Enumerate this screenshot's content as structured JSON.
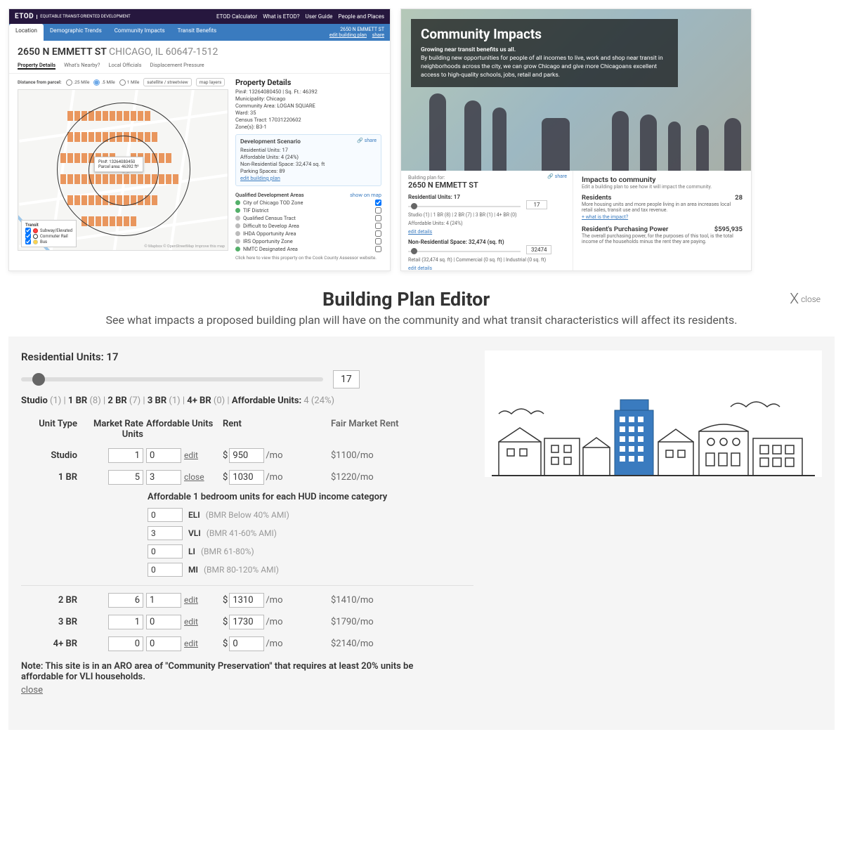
{
  "header": {
    "logo": "ETOD",
    "tagline": "EQUITABLE TRANSIT-ORIENTED DEVELOPMENT",
    "nav": [
      "ETOD Calculator",
      "What is ETOD?",
      "User Guide",
      "People and Places"
    ]
  },
  "subheader": {
    "tabs": [
      "Location",
      "Demographic Trends",
      "Community Impacts",
      "Transit Benefits"
    ],
    "right_addr": "2650 N EMMETT ST",
    "right_edit": "edit building plan",
    "right_share": "share"
  },
  "address": {
    "street": "2650 N EMMETT ST",
    "city": "CHICAGO, IL 60647-1512"
  },
  "prop_tabs": [
    "Property Details",
    "What's Nearby?",
    "Local Officials",
    "Displacement Pressure"
  ],
  "map": {
    "dist_label": "Distance from parcel:",
    "radii": [
      ".25 Mile",
      ".5 Mile",
      "1 Mile"
    ],
    "sat": "satellite / streetview",
    "layers": "map layers",
    "popup_pin": "Pin#: 13264080450",
    "popup_area": "Parcel area: 46392 ft²",
    "legend_title": "Transit",
    "legend": [
      "Subway/Elevated",
      "Commuter Rail",
      "Bus"
    ],
    "credit": "© Mapbox © OpenStreetMap Improve this map"
  },
  "details": {
    "title": "Property Details",
    "pin": "Pin#: 13264080450 | Sq. Ft.: 46392",
    "muni": "Municipality: Chicago",
    "commarea": "Community Area: LOGAN SQUARE",
    "ward": "Ward: 35",
    "census": "Census Tract: 17031220602",
    "zone": "Zone(s): B3-1",
    "dev_title": "Development Scenario",
    "dev_share": "share",
    "dev_ru": "Residential Units: 17",
    "dev_au": "Affordable Units: 4 (24%)",
    "dev_nrs": "Non-Residential Space: 32,474 sq. ft",
    "dev_ps": "Parking Spaces: 89",
    "dev_edit": "edit building plan",
    "qda_title": "Qualified Development Areas",
    "qda_show": "show on map",
    "qda": [
      {
        "label": "City of Chicago TOD Zone",
        "color": "#54b06a",
        "checked": true
      },
      {
        "label": "TIF District",
        "color": "#54b06a",
        "checked": false
      },
      {
        "label": "Qualified Census Tract",
        "color": "#bcbcbc",
        "checked": false
      },
      {
        "label": "Difficult to Develop Area",
        "color": "#bcbcbc",
        "checked": false
      },
      {
        "label": "IHDA Opportunity Area",
        "color": "#bcbcbc",
        "checked": false
      },
      {
        "label": "IRS Opportunity Zone",
        "color": "#bcbcbc",
        "checked": false
      },
      {
        "label": "NMTC Designated Area",
        "color": "#54b06a",
        "checked": false
      }
    ],
    "click_here": "Click here to view this property on the Cook County Assessor website."
  },
  "community": {
    "title": "Community Impacts",
    "lead": "Growing near transit benefits us all.",
    "body": "By building new opportunities for people of all incomes to live, work and shop near transit in neighborhoods across the city, we can grow Chicago and give more Chicagoans excellent access to high-quality schools, jobs, retail and parks.",
    "bp_for": "Building plan for:",
    "bp_addr": "2650 N EMMETT ST",
    "bp_share": "share",
    "bp_ru": "Residential Units: 17",
    "bp_ru_val": "17",
    "bp_mix": "Studio (1)  |  1 BR (8)  |  2 BR (7)  |  3 BR (1)  |  4+ BR (0)",
    "bp_au": "Affordable Units: 4 (24%)",
    "bp_au_edit": "edit details",
    "bp_nrs": "Non-Residential Space: 32,474 (sq. ft)",
    "bp_nrs_val": "32474",
    "bp_nrs_mix": "Retail (32,474 sq. ft)  |  Commercial (0 sq. ft)  |  Industrial (0 sq. ft)",
    "bp_nrs_edit": "edit details",
    "bp_ps": "Parking Spaces: 89",
    "impacts_title": "Impacts to community",
    "impacts_sub": "Edit a building plan to see how it will impact the community.",
    "residents_label": "Residents",
    "residents_val": "28",
    "residents_desc": "More housing units and more people living in an area increases local retail sales, transit use and tax revenue.",
    "residents_link": "+ what is the impact?",
    "rpp_label": "Resident's Purchasing Power",
    "rpp_val": "$595,935",
    "rpp_desc": "The overall purchasing power, for the purposes of this tool, is the total income of the households minus the rent they are paying."
  },
  "editor": {
    "title": "Building Plan Editor",
    "sub": "See what impacts a proposed building plan will have on the community and what transit characteristics will affect its residents.",
    "close": "close",
    "ru_label": "Residential Units: 17",
    "ru_val": "17",
    "mix_parts": [
      {
        "t": "Studio ",
        "g": "(1)  |  "
      },
      {
        "t": "1 BR ",
        "g": "(8)  |  "
      },
      {
        "t": "2 BR ",
        "g": "(7)  |  "
      },
      {
        "t": "3 BR ",
        "g": "(1)  |  "
      },
      {
        "t": "4+ BR ",
        "g": "(0)  |  "
      },
      {
        "t": "Affordable Units: ",
        "g": "4 (24%)"
      }
    ],
    "th": [
      "Unit Type",
      "Market Rate Units",
      "Affordable Units",
      "Rent",
      "Fair Market Rent"
    ],
    "rows": [
      {
        "type": "Studio",
        "mr": "1",
        "au": "0",
        "aedit": "edit",
        "rent": "950",
        "fmr": "$1100/mo"
      },
      {
        "type": "1 BR",
        "mr": "5",
        "au": "3",
        "aedit": "close",
        "rent": "1030",
        "fmr": "$1220/mo"
      }
    ],
    "hud_title": "Affordable 1 bedroom units for each HUD income category",
    "hud": [
      {
        "v": "0",
        "label": "ELI",
        "desc": "(BMR Below 40% AMI)"
      },
      {
        "v": "3",
        "label": "VLI",
        "desc": "(BMR 41-60% AMI)"
      },
      {
        "v": "0",
        "label": "LI",
        "desc": "(BMR 61-80%)"
      },
      {
        "v": "0",
        "label": "MI",
        "desc": "(BMR 80-120% AMI)"
      }
    ],
    "rows2": [
      {
        "type": "2 BR",
        "mr": "6",
        "au": "1",
        "aedit": "edit",
        "rent": "1310",
        "fmr": "$1410/mo"
      },
      {
        "type": "3 BR",
        "mr": "1",
        "au": "0",
        "aedit": "edit",
        "rent": "1730",
        "fmr": "$1790/mo"
      },
      {
        "type": "4+ BR",
        "mr": "0",
        "au": "0",
        "aedit": "edit",
        "rent": "0",
        "fmr": "$2140/mo"
      }
    ],
    "note": "Note: This site is in an ARO area of \"Community Preservation\" that requires at least 20% units be affordable for VLI households.",
    "close_link": "close",
    "prefix": "$",
    "suffix": "/mo"
  }
}
